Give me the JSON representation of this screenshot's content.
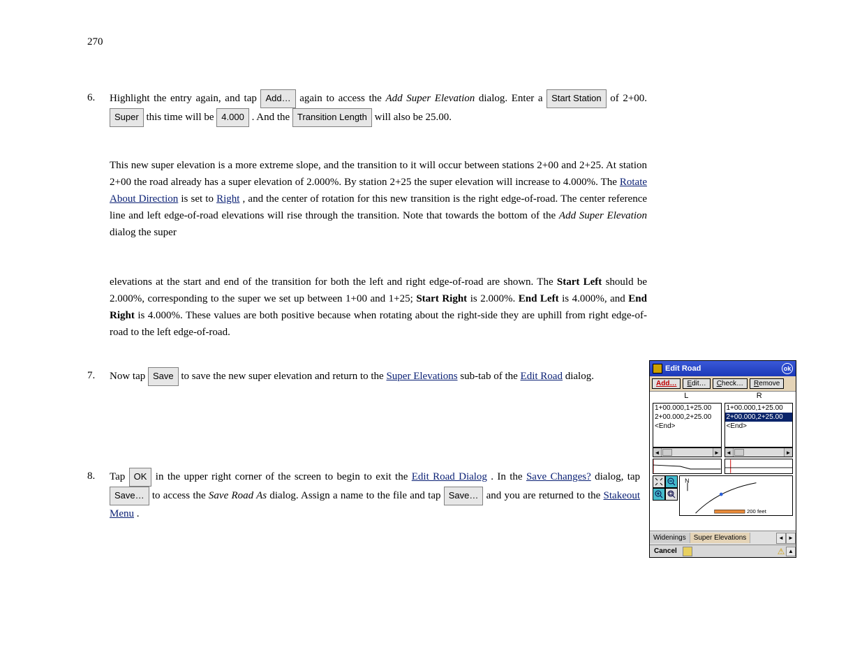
{
  "page_number": "270",
  "para1_before_addsuper": "Highlight the entry again, and tap",
  "btn_addsuper": "Add…",
  "para1_after_addsuper": "again to access the",
  "italic_add_super_dlg": "Add Super Elevation",
  "para1_after_dlg": "dialog. Enter a",
  "btn_start_station": "Start Station",
  "para1_start_stn_val": "of 2+00.",
  "btn_super": "Super",
  "para1_super_time": "this time will be",
  "btn_super_val": "4.000",
  "para1_and": ". And the",
  "btn_transition_length": "Transition Length",
  "para1_tl_val": "will also be 25.00.",
  "para2_pre": "This new super elevation is a more extreme slope, and the transition to it will occur between stations 2+00 and 2+25. At station 2+00 the road already has a super elevation of 2.000%. By station 2+25 the super elevation will increase to 4.000%. The",
  "link_direction": "Rotate About Direction",
  "para2_mid1": "is set to",
  "link_right": "Right",
  "para2_mid2": ", and the center of rotation for this new transition is the right edge-of-road. The center reference line and left edge-of-road elevations will rise through the transition. Note that towards the bottom of the",
  "italic_add_super_dlg2": "Add Super Elevation",
  "para2_tail": "dialog the super",
  "para3_start": "elevations at the start and end of the transition for both the left and right edge-of-road are shown. The",
  "label_startleft": "Start Left",
  "para3_sl": "should be 2.000%, corresponding to the super we set up between 1+00 and 1+25;",
  "label_startright": "Start Right",
  "para3_sr": "is 2.000%.",
  "label_endleft": "End Left",
  "para3_el_text": "is 4.000%, and",
  "label_endright": "End Right",
  "para3_er": "is 4.000%. These values are both positive because when rotating about the right-side they are uphill from right edge-of-road to the left edge-of-road.",
  "para4_before_save": "Now tap",
  "btn_save1": "Save",
  "para4_after_save": "to save the new super elevation and return to the",
  "link_super_elevations": "Super Elevations",
  "para4_subtab": "sub-tab of the",
  "link_edit_road": "Edit Road",
  "para4_dialog": "dialog.",
  "para5_pre": "Tap",
  "btn_ok": "OK",
  "para5_after_ok": "in the upper right corner of the screen to begin to exit the",
  "link_edit_road2": "Edit Road Dialog",
  "para5_mid": ". In the",
  "link_save_changes": "Save Changes?",
  "para5_dialog_tap": "dialog, tap",
  "btn_save2": "Save…",
  "para5_to_access": "to access the",
  "italic_save_road_as": "Save Road As",
  "para5_tail": "dialog. Assign a name to the file and tap",
  "btn_save3": "Save…",
  "para5_returned": "and you are returned to the",
  "link_stakeout_menu": "Stakeout Menu",
  "para5_period": ".",
  "device": {
    "title": "Edit Road",
    "ok": "ok",
    "toolbar": {
      "add": "Add…",
      "edit": "Edit…",
      "check": "Check…",
      "remove": "Remove"
    },
    "headers": {
      "left": "L",
      "right": "R"
    },
    "list_left": [
      "1+00.000,1+25.00",
      "2+00.000,2+25.00",
      "<End>"
    ],
    "list_right": [
      "1+00.000,1+25.00",
      "2+00.000,2+25.00",
      "<End>"
    ],
    "scale_label": "200 feet",
    "tabs": {
      "widenings": "Widenings",
      "super": "Super Elevations"
    },
    "cancel": "Cancel"
  }
}
